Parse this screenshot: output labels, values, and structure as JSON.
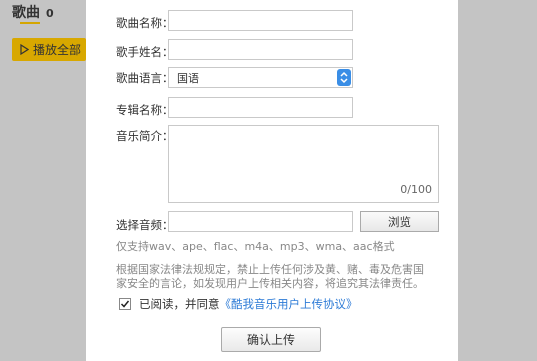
{
  "background": {
    "title": "歌曲",
    "count": "0",
    "play_all_label": "播放全部"
  },
  "form": {
    "song_name_label": "歌曲名称：",
    "song_name_value": "",
    "singer_label": "歌手姓名：",
    "singer_value": "",
    "language_label": "歌曲语言：",
    "language_value": "国语",
    "album_label": "专辑名称：",
    "album_value": "",
    "intro_label": "音乐简介：",
    "intro_value": "",
    "intro_counter": "0/100",
    "audio_label": "选择音频：",
    "audio_value": "",
    "browse_label": "浏览",
    "support_note": "仅支持wav、ape、flac、m4a、mp3、wma、aac格式",
    "legal_note_line1": "根据国家法律法规规定，禁止上传任何涉及黄、赌、毒及危害国",
    "legal_note_line2": "家安全的言论，如发现用户上传相关内容，将追究其法律责任。",
    "agree_prefix": "已阅读，并同意",
    "agree_link": "《酷我音乐用户上传协议》",
    "agree_checked": true,
    "confirm_label": "确认上传"
  },
  "colors": {
    "accent": "#d8a800",
    "select_arrow": "#3a8ee6",
    "link": "#2d7bd6"
  }
}
